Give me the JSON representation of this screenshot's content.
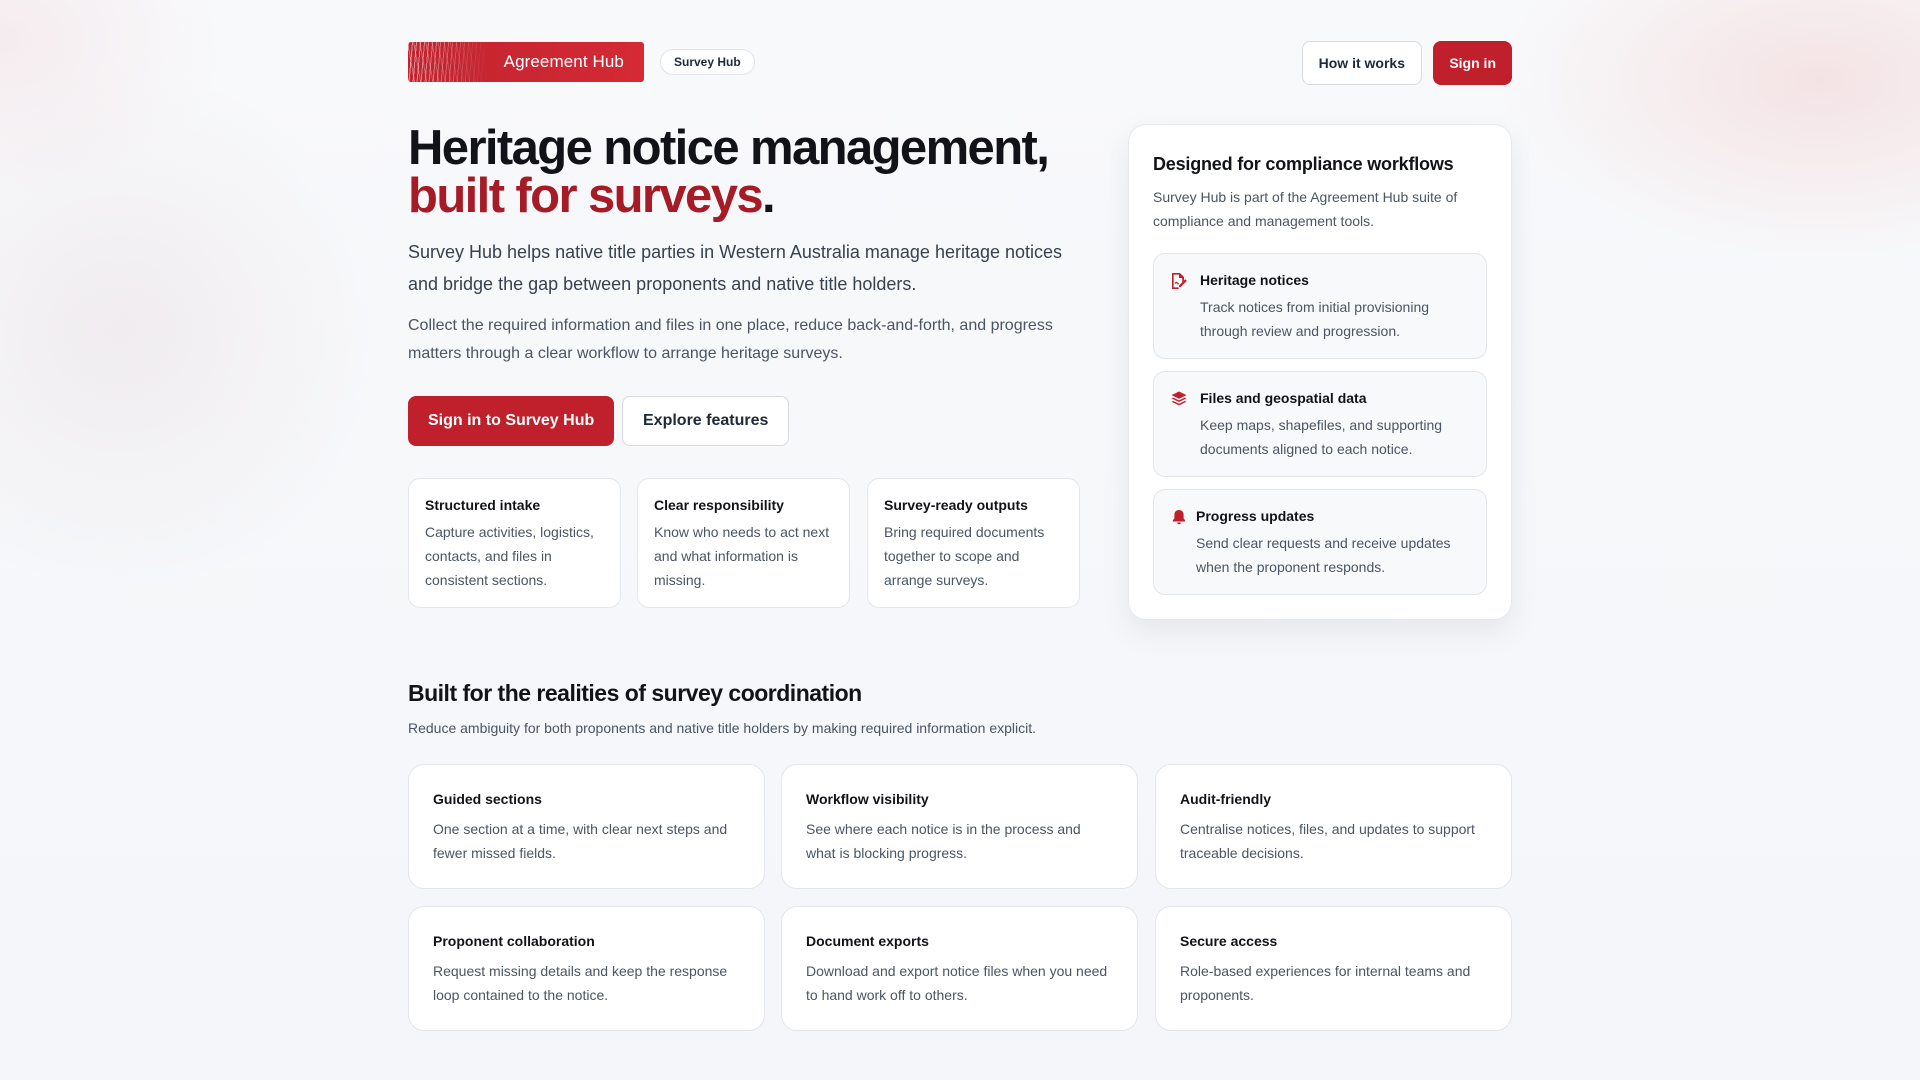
{
  "header": {
    "brand": "Agreement Hub",
    "product_pill": "Survey Hub",
    "how_it_works": "How it works",
    "sign_in": "Sign in"
  },
  "hero": {
    "title_line1": "Heritage notice management,",
    "title_line2_accent": "built for surveys",
    "title_line2_end": ".",
    "lead": "Survey Hub helps native title parties in Western Australia manage heritage notices and bridge the gap between proponents and native title holders.",
    "body": "Collect the required information and files in one place, reduce back-and-forth, and progress matters through a clear workflow to arrange heritage surveys.",
    "primary_cta": "Sign in to Survey Hub",
    "secondary_cta": "Explore features",
    "cards": [
      {
        "title": "Structured intake",
        "text": "Capture activities, logistics, contacts, and files in consistent sections."
      },
      {
        "title": "Clear responsibility",
        "text": "Know who needs to act next and what information is missing."
      },
      {
        "title": "Survey-ready outputs",
        "text": "Bring required documents together to scope and arrange surveys."
      }
    ]
  },
  "panel": {
    "title": "Designed for compliance workflows",
    "desc": "Survey Hub is part of the Agreement Hub suite of compliance and management tools.",
    "features": [
      {
        "icon": "file-signature-icon",
        "title": "Heritage notices",
        "text": "Track notices from initial provisioning through review and progression."
      },
      {
        "icon": "layers-icon",
        "title": "Files and geospatial data",
        "text": "Keep maps, shapefiles, and supporting documents aligned to each notice."
      },
      {
        "icon": "bell-icon",
        "title": "Progress updates",
        "text": "Send clear requests and receive updates when the proponent responds."
      }
    ]
  },
  "section": {
    "title": "Built for the realities of survey coordination",
    "subtitle": "Reduce ambiguity for both proponents and native title holders by making required information explicit.",
    "cards": [
      {
        "title": "Guided sections",
        "text": "One section at a time, with clear next steps and fewer missed fields."
      },
      {
        "title": "Workflow visibility",
        "text": "See where each notice is in the process and what is blocking progress."
      },
      {
        "title": "Audit-friendly",
        "text": "Centralise notices, files, and updates to support traceable decisions."
      },
      {
        "title": "Proponent collaboration",
        "text": "Request missing details and keep the response loop contained to the notice."
      },
      {
        "title": "Document exports",
        "text": "Download and export notice files when you need to hand work off to others."
      },
      {
        "title": "Secure access",
        "text": "Role-based experiences for internal teams and proponents."
      }
    ]
  },
  "colors": {
    "accent": "#c0202c",
    "accent_dark": "#a51c26"
  }
}
